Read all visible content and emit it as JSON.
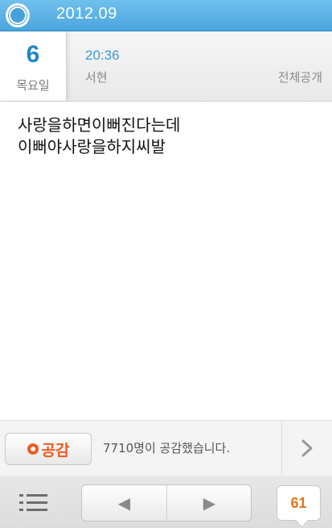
{
  "topbar": {
    "logo_icon": "app-logo-icon",
    "month": "2012.09"
  },
  "header": {
    "day": "6",
    "weekday": "목요일",
    "time": "20:36",
    "location": "서현",
    "privacy": "전체공개"
  },
  "post": {
    "lines": [
      "사랑을하면이뻐진다는데",
      "이뻐야사랑을하지씨발"
    ]
  },
  "empathy": {
    "button_label": "공감",
    "count_text": "7710명이 공감했습니다.",
    "arrow_icon": "chevron-right-icon"
  },
  "bottombar": {
    "list_icon": "list-icon",
    "prev_glyph": "◀",
    "next_glyph": "▶",
    "page_number": "61"
  },
  "colors": {
    "accent_blue": "#4aa6dd",
    "empathy_orange": "#f05a22",
    "page_orange": "#e8741a"
  }
}
